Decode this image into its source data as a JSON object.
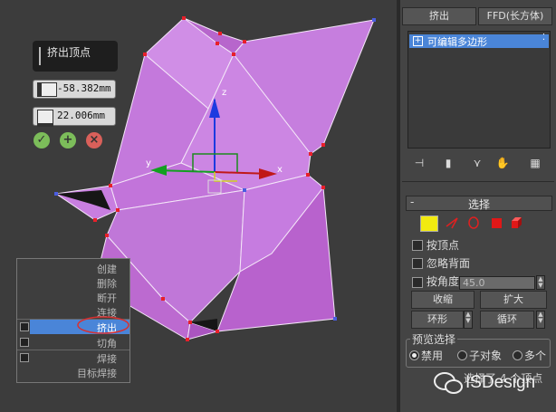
{
  "caddy": {
    "title": "挤出顶点",
    "height_value": "-58.382mm",
    "width_value": "22.006mm",
    "ok_icon": "check-icon",
    "apply_icon": "plus-icon",
    "cancel_icon": "x-icon"
  },
  "viewport": {
    "mesh_color": "#c36bd8",
    "axis_labels": {
      "z": "z",
      "x": "x",
      "y": "y"
    }
  },
  "context_menu": {
    "items": [
      {
        "label": "创建"
      },
      {
        "label": "删除"
      },
      {
        "label": "断开"
      },
      {
        "label": "连接"
      },
      {
        "label": "挤出",
        "selected": true
      },
      {
        "label": "切角"
      },
      {
        "label": "焊接"
      },
      {
        "label": "目标焊接"
      }
    ]
  },
  "panel": {
    "top_buttons": {
      "extrude": "挤出",
      "ffd": "FFD(长方体)"
    },
    "modifier_stack": {
      "item": "可编辑多边形"
    },
    "selection_rollout": {
      "title": "选择",
      "checkboxes": {
        "by_vertex": "按顶点",
        "ignore_backface": "忽略背面",
        "by_angle": "按角度:"
      },
      "angle_value": "45.0",
      "buttons": {
        "shrink": "收缩",
        "grow": "扩大",
        "ring": "环形",
        "loop": "循环"
      },
      "preview": {
        "title": "预览选择",
        "options": [
          "禁用",
          "子对象",
          "多个"
        ],
        "selected": "禁用"
      },
      "status_text": "选择了 4 个顶点"
    }
  },
  "watermark": {
    "text": "ISDesign"
  }
}
